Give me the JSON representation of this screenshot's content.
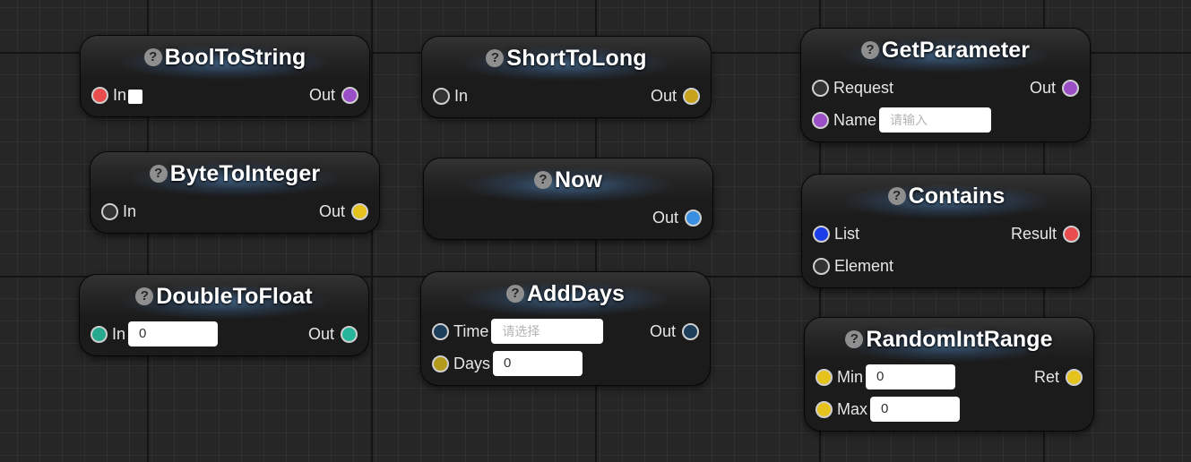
{
  "nodes": {
    "bool_to_string": {
      "title": "BoolToString",
      "in_label": "In",
      "out_label": "Out",
      "pin_colors": {
        "in": "#e84c4c",
        "out": "#9b4fc7"
      }
    },
    "byte_to_integer": {
      "title": "ByteToInteger",
      "in_label": "In",
      "out_label": "Out",
      "pin_colors": {
        "in": "#333333",
        "out": "#e6c21c"
      }
    },
    "double_to_float": {
      "title": "DoubleToFloat",
      "in_label": "In",
      "in_value": "0",
      "out_label": "Out",
      "pin_colors": {
        "in": "#26a88f",
        "out": "#26b49a"
      }
    },
    "short_to_long": {
      "title": "ShortToLong",
      "in_label": "In",
      "out_label": "Out",
      "pin_colors": {
        "in": "#333333",
        "out": "#c7a21a"
      }
    },
    "now": {
      "title": "Now",
      "out_label": "Out",
      "pin_colors": {
        "out": "#3a8fe0"
      }
    },
    "add_days": {
      "title": "AddDays",
      "time_label": "Time",
      "time_placeholder": "请选择",
      "days_label": "Days",
      "days_value": "0",
      "out_label": "Out",
      "pin_colors": {
        "time": "#1d3f5c",
        "days": "#b39a1a",
        "out": "#1d3f5c"
      }
    },
    "get_parameter": {
      "title": "GetParameter",
      "request_label": "Request",
      "name_label": "Name",
      "name_placeholder": "请输入",
      "out_label": "Out",
      "pin_colors": {
        "request": "#333333",
        "name": "#9b4fc7",
        "out": "#9b4fc7"
      }
    },
    "contains": {
      "title": "Contains",
      "list_label": "List",
      "element_label": "Element",
      "result_label": "Result",
      "pin_colors": {
        "list": "#1a3fe8",
        "element": "#333333",
        "result": "#e84c4c"
      }
    },
    "random_int_range": {
      "title": "RandomIntRange",
      "min_label": "Min",
      "min_value": "0",
      "max_label": "Max",
      "max_value": "0",
      "ret_label": "Ret",
      "pin_colors": {
        "min": "#e6c21c",
        "max": "#e6c21c",
        "ret": "#e6c21c"
      }
    }
  },
  "icons": {
    "help": "?"
  }
}
